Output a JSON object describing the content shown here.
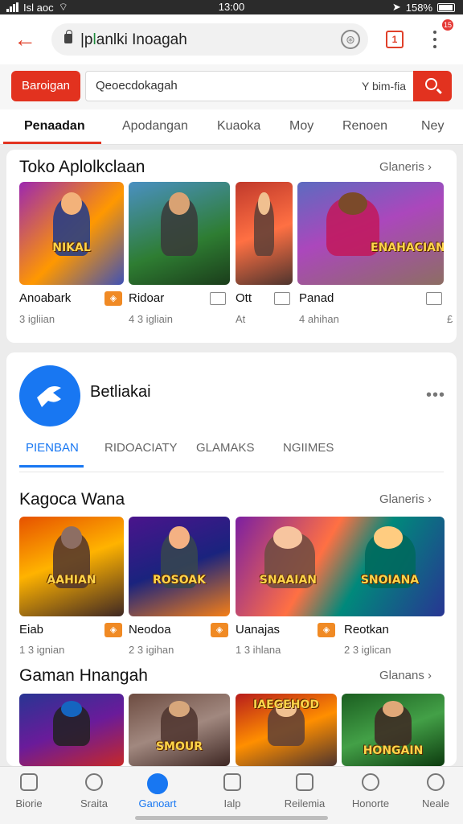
{
  "status_bar": {
    "carrier": "Isl aoc",
    "time": "13:00",
    "battery": "158%",
    "notification_count": "15"
  },
  "url_bar": {
    "url_prefix": "|p",
    "url_green": "l",
    "url_rest": "anlki Inoagah",
    "tab_count": "1"
  },
  "search": {
    "brand_label": "Baroigan",
    "placeholder": "Qeoecdokagah",
    "filter_label": "Y bim-fia"
  },
  "category_tabs": [
    {
      "label": "Penaadan"
    },
    {
      "label": "Apodangan"
    },
    {
      "label": "Kuaoka"
    },
    {
      "label": "Moy"
    },
    {
      "label": "Renoen"
    },
    {
      "label": "Ney"
    }
  ],
  "section1": {
    "title": "Toko Aplolkclaan",
    "see_all": "Glaneris",
    "apps": [
      {
        "name": "Anoabark",
        "meta": "3 igliian",
        "badge": "◈"
      },
      {
        "name": "Ridoar",
        "meta": "4 3 igliain",
        "badge": ""
      },
      {
        "name": "Ott",
        "meta": "At",
        "badge": ""
      },
      {
        "name": "Panad",
        "meta": "4 ahihan",
        "badge": ""
      }
    ],
    "tile_words": [
      "NIKAL",
      "",
      "",
      "ENAHACIAN"
    ],
    "trailing_meta": "£"
  },
  "developer": {
    "name": "Betliakai",
    "more": "•••",
    "tabs": [
      {
        "label": "PIENBAN"
      },
      {
        "label": "RIDOACIATY"
      },
      {
        "label": "GLAMAKS"
      },
      {
        "label": "NGIIMES"
      }
    ]
  },
  "section2": {
    "title": "Kagoca Wana",
    "see_all": "Glaneris",
    "apps": [
      {
        "name": "Eiab",
        "meta": "1 3 ignian",
        "badge": "◈"
      },
      {
        "name": "Neodoa",
        "meta": "2 3 igihan",
        "badge": "◈"
      },
      {
        "name": "Uanajas",
        "meta": "1 3 ihlana",
        "badge": "◈"
      },
      {
        "name": "Reotkan",
        "meta": "2 3 iglican",
        "badge": ""
      }
    ],
    "tile_words": [
      "AAHIAN",
      "ROSOAK",
      "SNAAIAN",
      "SNOIANA"
    ]
  },
  "section3": {
    "title": "Gaman Hnangah",
    "see_all": "Glanans",
    "tile_words": [
      "",
      "SMOUR",
      "IAEGEHOD",
      "HONGAIN"
    ]
  },
  "bottom_nav": [
    {
      "label": "Biorie",
      "icon": "store-icon"
    },
    {
      "label": "Sraita",
      "icon": "search-icon"
    },
    {
      "label": "Ganoart",
      "icon": "games-icon"
    },
    {
      "label": "Ialp",
      "icon": "apps-icon"
    },
    {
      "label": "Reilemia",
      "icon": "books-icon"
    },
    {
      "label": "Honorte",
      "icon": "rewards-icon"
    },
    {
      "label": "Neale",
      "icon": "profile-icon"
    }
  ],
  "colors": {
    "accent_red": "#e2321f",
    "accent_blue": "#1877f2",
    "badge_orange": "#f08a24"
  }
}
